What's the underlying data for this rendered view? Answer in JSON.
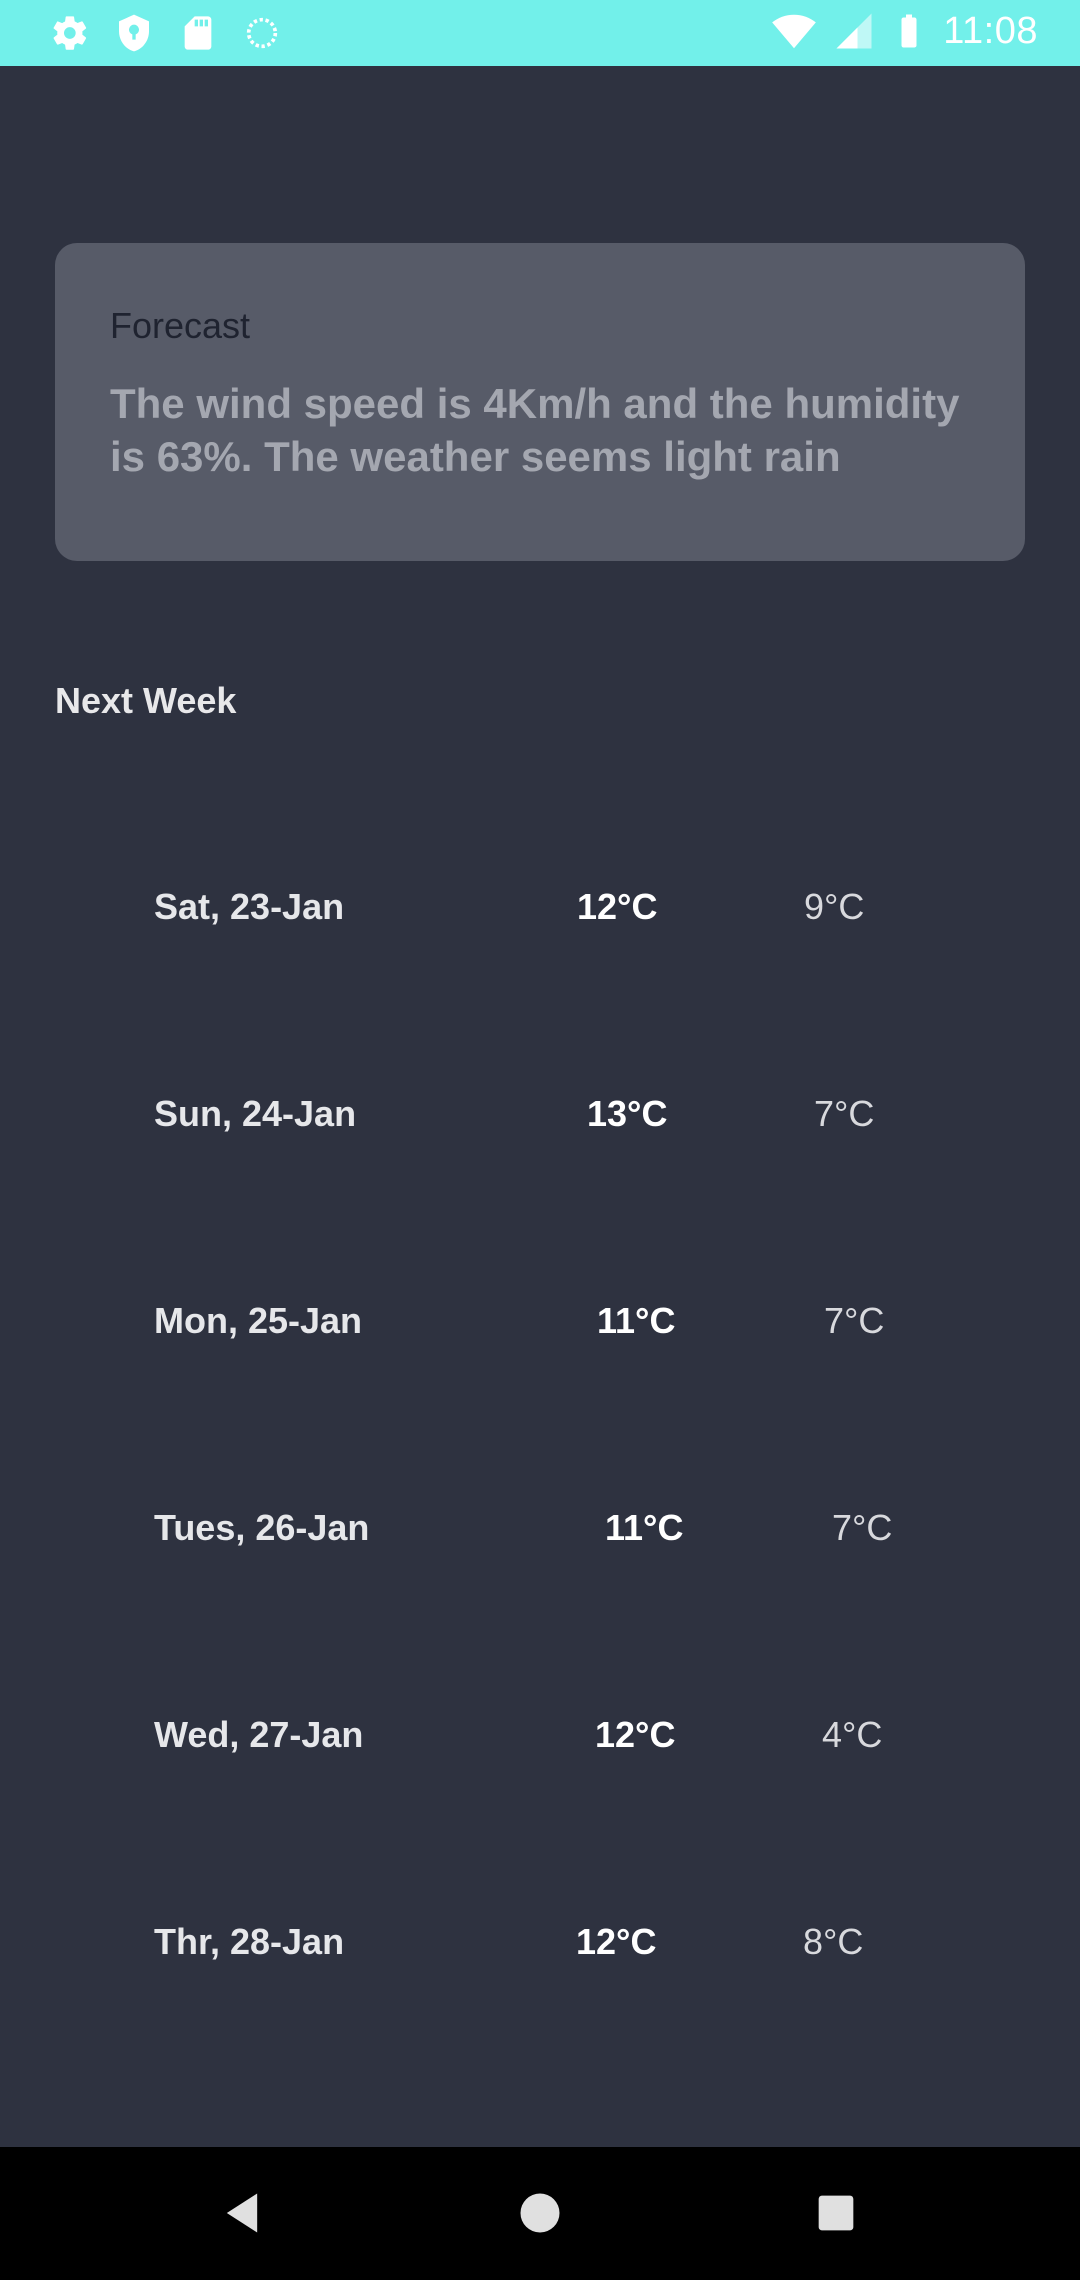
{
  "status_bar": {
    "time": "11:08",
    "icons_left": [
      "settings-icon",
      "shield-icon",
      "sd-card-icon",
      "sync-icon"
    ],
    "icons_right": [
      "wifi-icon",
      "cell-signal-icon",
      "battery-icon"
    ]
  },
  "forecast": {
    "title": "Forecast",
    "text": "The wind speed is 4Km/h and the humidity is 63%. The weather seems light rain"
  },
  "next_week": {
    "heading": "Next Week",
    "days": [
      {
        "date": "Sat, 23-Jan",
        "high": "12°C",
        "low": "9°C"
      },
      {
        "date": "Sun, 24-Jan",
        "high": "13°C",
        "low": "7°C"
      },
      {
        "date": "Mon, 25-Jan",
        "high": "11°C",
        "low": "7°C"
      },
      {
        "date": "Tues, 26-Jan",
        "high": "11°C",
        "low": "7°C"
      },
      {
        "date": "Wed, 27-Jan",
        "high": "12°C",
        "low": "4°C"
      },
      {
        "date": "Thr, 28-Jan",
        "high": "12°C",
        "low": "8°C"
      }
    ]
  },
  "nav_bar": {
    "buttons": [
      "back-icon",
      "home-icon",
      "recents-icon"
    ]
  },
  "colors": {
    "background": "#2e3240",
    "status_bar": "#72f0ea",
    "card": "#575b68",
    "nav_bar": "#000000"
  }
}
